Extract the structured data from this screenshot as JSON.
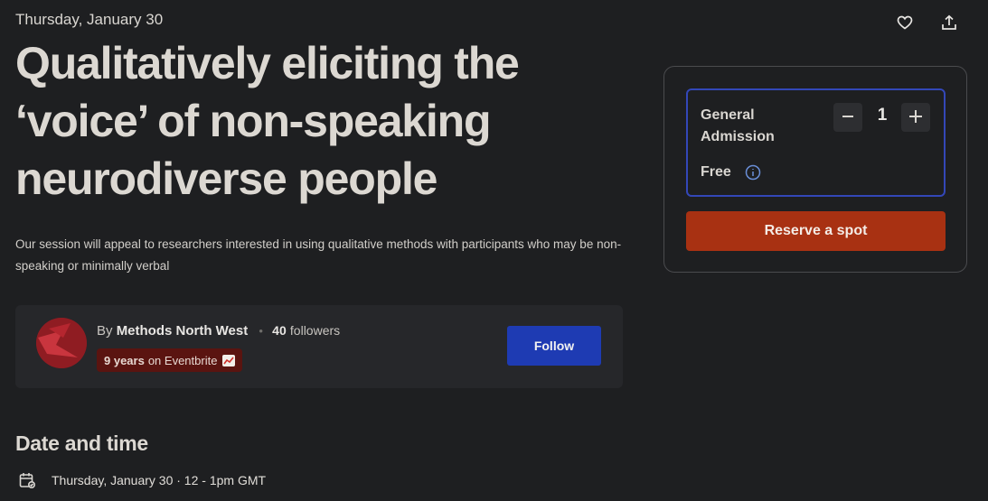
{
  "event": {
    "date_header": "Thursday, January 30",
    "title": "Qualitatively eliciting the ‘voice’ of non-speaking neurodiverse people",
    "summary": "Our session will appeal to researchers interested in using qualitative methods with participants who may be non-speaking or minimally verbal"
  },
  "actions": {
    "like_icon": "heart-icon",
    "share_icon": "share-icon"
  },
  "organizer": {
    "by_prefix": "By",
    "name": "Methods North West",
    "followers_count": "40",
    "followers_label": "followers",
    "badge_years": "9 years",
    "badge_suffix": "on Eventbrite",
    "follow_label": "Follow"
  },
  "date_time": {
    "heading": "Date and time",
    "value": "Thursday, January 30 · 12 - 1pm GMT",
    "icon": "calendar-icon"
  },
  "ticket": {
    "name": "General Admission",
    "price": "Free",
    "quantity": "1",
    "reserve_label": "Reserve a spot"
  },
  "colors": {
    "background": "#1e1f21",
    "follow_button": "#1e3bb3",
    "reserve_button": "#a83112",
    "ticket_border": "#3347b8",
    "badge_bg": "#5a1410"
  }
}
